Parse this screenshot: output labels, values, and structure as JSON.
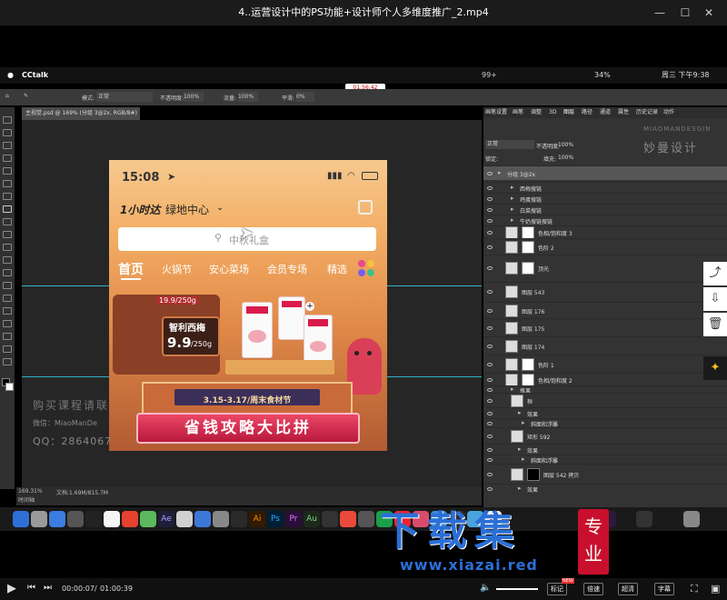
{
  "player": {
    "title": "4..运营设计中的PS功能+设计师个人多维度推广_2.mp4",
    "time_current": "00:00:07",
    "time_total": "01:00:39",
    "btn_mark": "标记",
    "btn_speed": "倍速",
    "btn_quality": "超清",
    "btn_subtitle": "字幕",
    "mark_badge": "NEW"
  },
  "mac": {
    "app": "CCtalk",
    "status_right": "34%",
    "datetime": "周三 下午9:38",
    "badge": "99+",
    "rec_time": "01:56:42"
  },
  "ps": {
    "doc_tab": "主视觉.psd @ 169% (分组 3@2x, RGB/8#) *",
    "zoom": "169.31%",
    "docsize": "文档:1.69M/815.7M",
    "timeline": "时间轴",
    "options": {
      "mode_label": "模式:",
      "mode": "正常",
      "opacity_label": "不透明度:",
      "opacity": "100%",
      "flow_label": "流量:",
      "flow": "100%",
      "smooth_label": "平滑:",
      "smooth": "0%"
    },
    "panel_tabs": [
      "画笔设置",
      "画笔",
      "调整",
      "3D",
      "图层",
      "路径",
      "通道",
      "属性",
      "历史记录",
      "动作"
    ],
    "layer_mode": "正常",
    "layer_opacity_label": "不透明度:",
    "layer_opacity": "100%",
    "lock_label": "锁定:",
    "fill_label": "填充:",
    "fill": "100%",
    "watermark_top": "MIAOMANDESGIN",
    "brand": "妙曼设计",
    "layers": [
      "分组 3@2x",
      "西梅搜链",
      "鸡蛋搜链",
      "白菜搜链",
      "牛奶搜链搜链",
      "色相/饱和度 3",
      "色阶 2",
      "顶光",
      "图层 543",
      "图层 176",
      "图层 175",
      "图层 174",
      "色阶 1",
      "色相/饱和度 2",
      "瓶果",
      "桓",
      "效果",
      "斜面和浮雕",
      "矩形 592",
      "效果",
      "斜面和浮雕",
      "图层 542 拷贝",
      "效果"
    ]
  },
  "phone": {
    "time": "15:08",
    "delivery_prefix": "1小时达",
    "location": "绿地中心",
    "search_placeholder": "中秋礼盒",
    "tabs": [
      "首页",
      "火锅节",
      "安心菜场",
      "会员专场",
      "精选"
    ],
    "price_tag": "19.9/250g",
    "product_name": "智利西梅",
    "price": "9.9",
    "unit": "/250g",
    "date_banner": "3.15-3.17/周末食材节",
    "main_banner": "省钱攻略大比拼",
    "carton_text": "牛奶"
  },
  "overlay": {
    "buy_text": "购买课程请联",
    "wechat": "微信：MiaoManDe",
    "qq": "QQ：2864067",
    "site_big": "下载集",
    "site_badge": "专业",
    "site_url": "www.xiazai.red"
  },
  "colors": {
    "accent": "#d91a4b",
    "brand_blue": "#2d73c8",
    "orange": "#f2a95a"
  }
}
